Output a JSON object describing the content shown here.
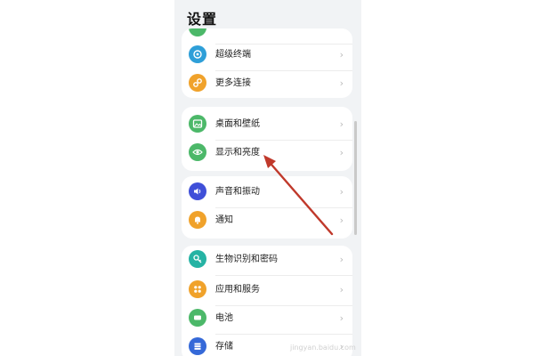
{
  "header": {
    "title": "设置"
  },
  "cards": [
    {
      "items": [
        {
          "label": "",
          "icon": "partial-icon",
          "color": "#4cb869"
        },
        {
          "label": "超级终端",
          "icon": "super-device-icon",
          "color": "#2e9fd8"
        },
        {
          "label": "更多连接",
          "icon": "link-icon",
          "color": "#f0a22b"
        }
      ]
    },
    {
      "items": [
        {
          "label": "桌面和壁纸",
          "icon": "wallpaper-icon",
          "color": "#4cb869"
        },
        {
          "label": "显示和亮度",
          "icon": "eye-icon",
          "color": "#4cb869"
        }
      ]
    },
    {
      "items": [
        {
          "label": "声音和振动",
          "icon": "speaker-icon",
          "color": "#3f4fd8"
        },
        {
          "label": "通知",
          "icon": "bell-icon",
          "color": "#f0a22b"
        }
      ]
    },
    {
      "items": [
        {
          "label": "生物识别和密码",
          "icon": "key-icon",
          "color": "#26b3a4"
        },
        {
          "label": "应用和服务",
          "icon": "apps-icon",
          "color": "#f0a22b"
        },
        {
          "label": "电池",
          "icon": "battery-icon",
          "color": "#4cb869"
        },
        {
          "label": "存储",
          "icon": "storage-icon",
          "color": "#3569d8"
        }
      ]
    }
  ],
  "chevron": "›",
  "annotation": {
    "color": "#c0392b"
  },
  "watermark": {
    "text": "jingyan.baidu.com"
  }
}
